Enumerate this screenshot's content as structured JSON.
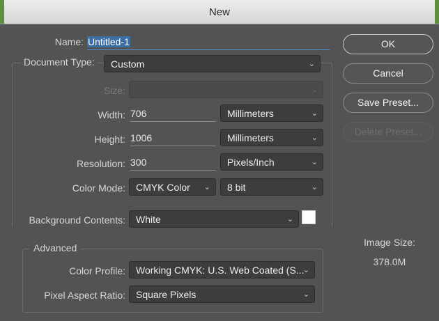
{
  "window": {
    "title": "New"
  },
  "form": {
    "name_label": "Name:",
    "name_value": "Untitled-1",
    "document_type_label": "Document Type:",
    "document_type_value": "Custom",
    "size_label": "Size:",
    "size_value": "",
    "width_label": "Width:",
    "width_value": "706",
    "width_unit": "Millimeters",
    "height_label": "Height:",
    "height_value": "1006",
    "height_unit": "Millimeters",
    "resolution_label": "Resolution:",
    "resolution_value": "300",
    "resolution_unit": "Pixels/Inch",
    "color_mode_label": "Color Mode:",
    "color_mode_value": "CMYK Color",
    "bit_depth_value": "8 bit",
    "background_label": "Background Contents:",
    "background_value": "White",
    "background_swatch_color": "#ffffff"
  },
  "advanced": {
    "legend": "Advanced",
    "color_profile_label": "Color Profile:",
    "color_profile_value": "Working CMYK:  U.S. Web Coated (S...",
    "pixel_aspect_label": "Pixel Aspect Ratio:",
    "pixel_aspect_value": "Square Pixels"
  },
  "buttons": {
    "ok": "OK",
    "cancel": "Cancel",
    "save_preset": "Save Preset...",
    "delete_preset": "Delete Preset..."
  },
  "image_size": {
    "label": "Image Size:",
    "value": "378.0M"
  },
  "colors": {
    "dialog_bg": "#535353",
    "titlebar_bg": "#e0e0e0",
    "accent": "#4f8fd8"
  }
}
